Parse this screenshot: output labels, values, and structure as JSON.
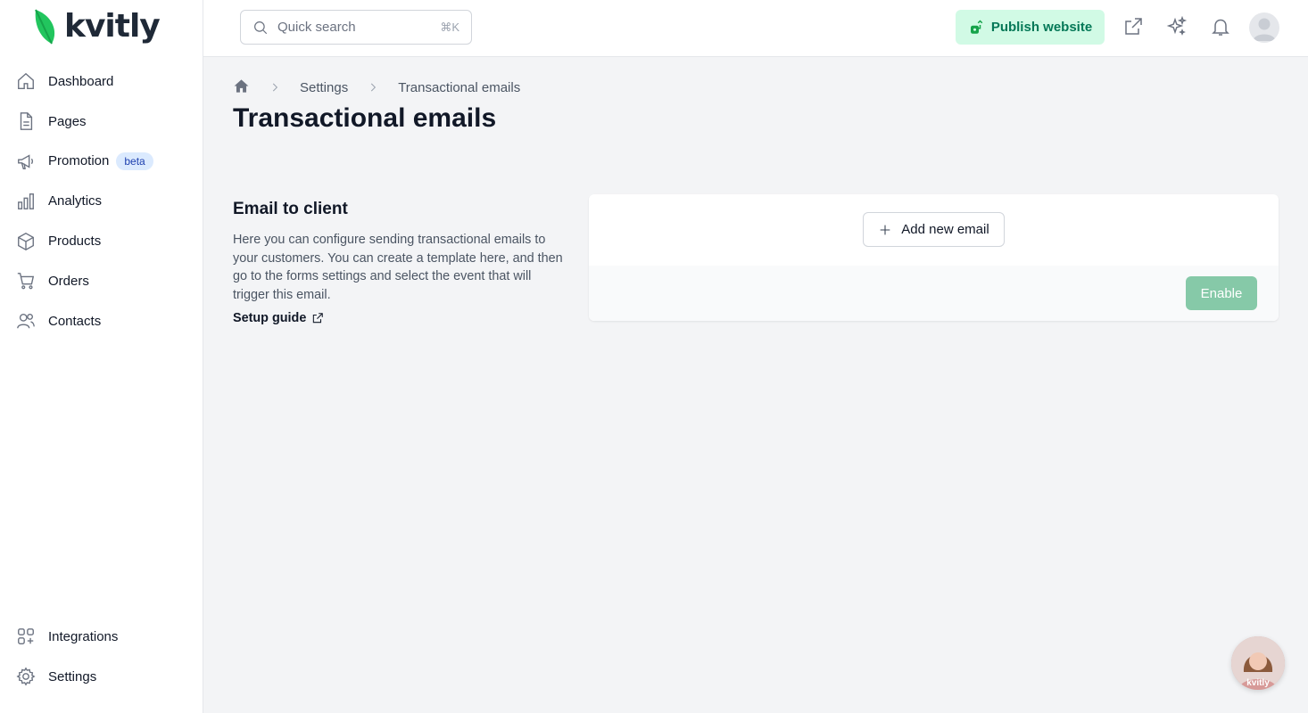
{
  "brand": {
    "name": "kvitly",
    "accent": "#22c55e"
  },
  "sidebar": {
    "items": [
      {
        "label": "Dashboard",
        "icon": "home-icon"
      },
      {
        "label": "Pages",
        "icon": "document-icon"
      },
      {
        "label": "Promotion",
        "icon": "megaphone-icon",
        "badge": "beta"
      },
      {
        "label": "Analytics",
        "icon": "bar-chart-icon"
      },
      {
        "label": "Products",
        "icon": "cube-icon"
      },
      {
        "label": "Orders",
        "icon": "cart-icon"
      },
      {
        "label": "Contacts",
        "icon": "users-icon"
      }
    ],
    "bottom_items": [
      {
        "label": "Integrations",
        "icon": "grid-plus-icon"
      },
      {
        "label": "Settings",
        "icon": "gear-icon"
      }
    ]
  },
  "topbar": {
    "search": {
      "placeholder": "Quick search",
      "shortcut": "⌘K"
    },
    "publish_label": "Publish website",
    "icons": [
      "external-link-icon",
      "sparkles-icon",
      "bell-icon",
      "avatar-icon"
    ]
  },
  "breadcrumb": {
    "items": [
      "Settings",
      "Transactional emails"
    ]
  },
  "page": {
    "title": "Transactional emails"
  },
  "section": {
    "title": "Email to client",
    "description": "Here you can configure sending transactional emails to your customers. You can create a template here, and then go to the forms settings and select the event that will trigger this email.",
    "link": "Setup guide"
  },
  "card": {
    "add_label": "Add new email",
    "enable_label": "Enable",
    "enable_color": "#86c9a8"
  },
  "chat": {
    "label": "kvitly"
  }
}
